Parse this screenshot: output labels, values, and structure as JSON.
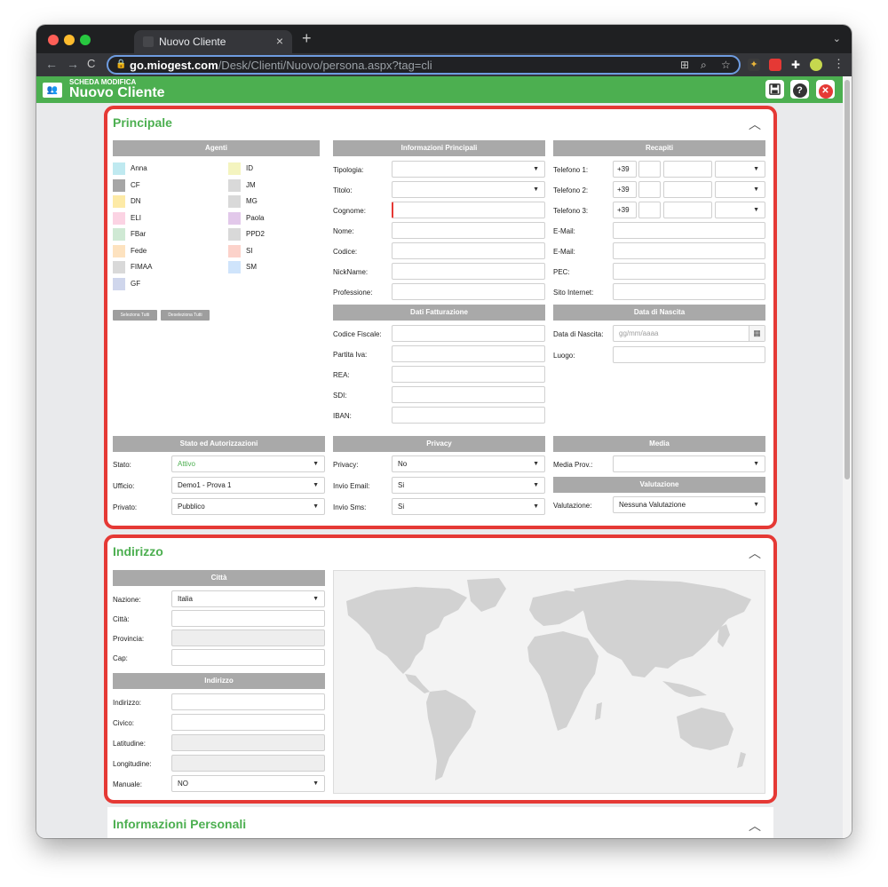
{
  "browser": {
    "tab_title": "Nuovo Cliente",
    "tab_close": "×",
    "new_tab": "+",
    "tabs_menu": "⌄",
    "url_domain": "go.miogest.com",
    "url_path": "/Desk/Clienti/Nuovo/persona.aspx?tag=cli"
  },
  "app": {
    "subtitle": "SCHEDA MODIFICA",
    "title": "Nuovo Cliente",
    "help_label": "?",
    "close_label": "✕"
  },
  "principale": {
    "title": "Principale",
    "agenti": {
      "header": "Agenti",
      "items": [
        {
          "label": "Anna",
          "color": "#bfe9f0"
        },
        {
          "label": "ID",
          "color": "#f4f4bf"
        },
        {
          "label": "CF",
          "color": "#a6a6a6"
        },
        {
          "label": "JM",
          "color": "#d9d9d9"
        },
        {
          "label": "DN",
          "color": "#fdeaa6"
        },
        {
          "label": "MG",
          "color": "#d9d9d9"
        },
        {
          "label": "ELI",
          "color": "#fbd3e3"
        },
        {
          "label": "Paola",
          "color": "#e2c8ea"
        },
        {
          "label": "FBar",
          "color": "#cfe9d4"
        },
        {
          "label": "PPD2",
          "color": "#d9d9d9"
        },
        {
          "label": "Fede",
          "color": "#fde2bf"
        },
        {
          "label": "SI",
          "color": "#fcd2ca"
        },
        {
          "label": "FIMAA",
          "color": "#d9d9d9"
        },
        {
          "label": "SM",
          "color": "#cfe4fb"
        },
        {
          "label": "GF",
          "color": "#cfd6ec"
        }
      ],
      "select_all": "Seleziona Tutti",
      "deselect_all": "Deseleziona Tutti"
    },
    "info": {
      "header": "Informazioni Principali",
      "fields": [
        "Tipologia:",
        "Titolo:",
        "Cognome:",
        "Nome:",
        "Codice:",
        "NickName:",
        "Professione:"
      ]
    },
    "recapiti": {
      "header": "Recapiti",
      "phones": [
        {
          "label": "Telefono 1:",
          "prefix": "+39"
        },
        {
          "label": "Telefono 2:",
          "prefix": "+39"
        },
        {
          "label": "Telefono 3:",
          "prefix": "+39"
        }
      ],
      "fields": [
        "E-Mail:",
        "E-Mail:",
        "PEC:",
        "Sito Internet:"
      ]
    },
    "fatturazione": {
      "header": "Dati Fatturazione",
      "fields": [
        "Codice Fiscale:",
        "Partita Iva:",
        "REA:",
        "SDI:",
        "IBAN:"
      ]
    },
    "nascita": {
      "header": "Data di Nascita",
      "date_label": "Data di Nascita:",
      "date_placeholder": "gg/mm/aaaa",
      "luogo_label": "Luogo:"
    },
    "stato": {
      "header": "Stato ed Autorizzazioni",
      "rows": [
        {
          "label": "Stato:",
          "value": "Attivo"
        },
        {
          "label": "Ufficio:",
          "value": "Demo1 - Prova 1"
        },
        {
          "label": "Privato:",
          "value": "Pubblico"
        }
      ]
    },
    "privacy": {
      "header": "Privacy",
      "rows": [
        {
          "label": "Privacy:",
          "value": "No"
        },
        {
          "label": "Invio Email:",
          "value": "Si"
        },
        {
          "label": "Invio Sms:",
          "value": "Si"
        }
      ]
    },
    "media": {
      "header": "Media",
      "prov_label": "Media Prov.:",
      "prov_value": ""
    },
    "valutazione": {
      "header": "Valutazione",
      "label": "Valutazione:",
      "value": "Nessuna Valutazione"
    }
  },
  "indirizzo": {
    "title": "Indirizzo",
    "citta": {
      "header": "Città",
      "rows": [
        {
          "label": "Nazione:",
          "value": "Italia"
        },
        {
          "label": "Città:",
          "value": ""
        },
        {
          "label": "Provincia:",
          "value": ""
        },
        {
          "label": "Cap:",
          "value": ""
        }
      ]
    },
    "indirizzo_box": {
      "header": "Indirizzo",
      "rows": [
        {
          "label": "Indirizzo:",
          "value": ""
        },
        {
          "label": "Civico:",
          "value": ""
        },
        {
          "label": "Latitudine:",
          "value": ""
        },
        {
          "label": "Longitudine:",
          "value": ""
        },
        {
          "label": "Manuale:",
          "value": "NO"
        }
      ]
    }
  },
  "info_personali": {
    "title": "Informazioni Personali"
  },
  "colors": {
    "accent_green": "#4caf50",
    "highlight_red": "#e53935",
    "header_grey": "#a9a9a9",
    "active_status": "#4caf50"
  }
}
